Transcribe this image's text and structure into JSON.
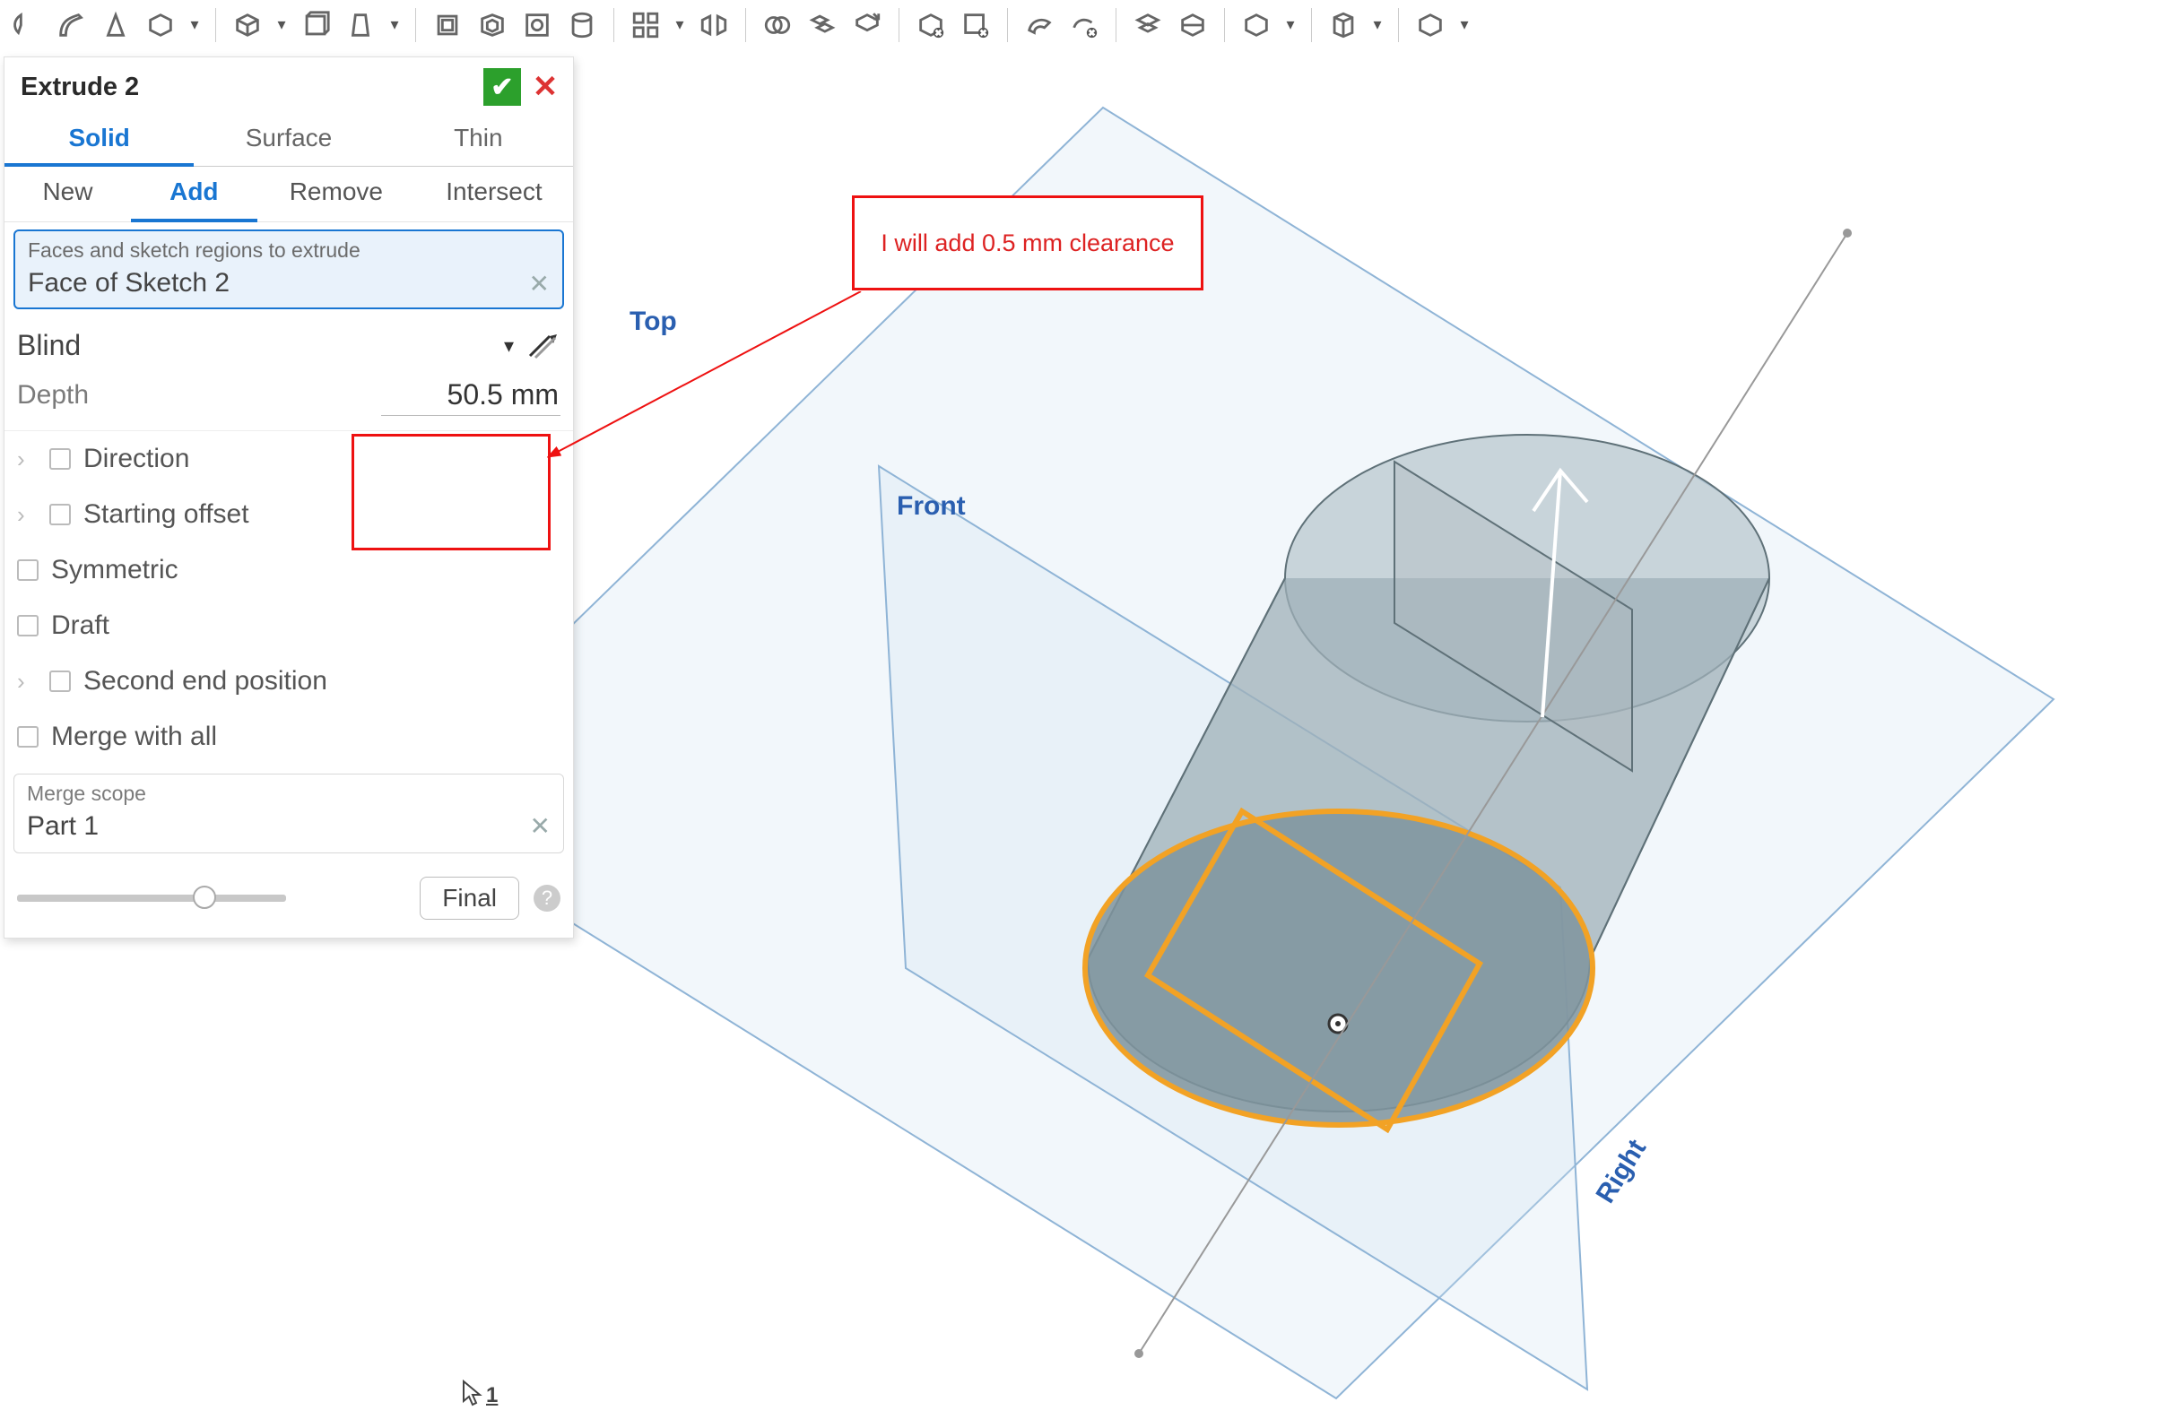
{
  "toolbar": {
    "icons": [
      "sketch-icon",
      "revolve-icon",
      "loft-icon",
      "thicken-icon",
      "sweep-icon",
      "extrude-icon",
      "surf1-icon",
      "surf2-icon",
      "surf3-icon",
      "fill-icon",
      "offset-icon",
      "plane-icon",
      "surf4-icon",
      "split-icon",
      "section-icon",
      "boolean-icon",
      "transform1-icon",
      "transform2-icon",
      "delete1-icon",
      "delete2-icon",
      "import1-icon",
      "import2-icon",
      "mirror-icon",
      "pattern-icon",
      "frame1-icon",
      "frame2-icon",
      "frame3-icon"
    ]
  },
  "panel": {
    "title": "Extrude 2",
    "tabs1": {
      "items": [
        "Solid",
        "Surface",
        "Thin"
      ],
      "active": 0
    },
    "tabs2": {
      "items": [
        "New",
        "Add",
        "Remove",
        "Intersect"
      ],
      "active": 1
    },
    "selection": {
      "label": "Faces and sketch regions to extrude",
      "value": "Face of Sketch 2"
    },
    "end_type": "Blind",
    "depth": {
      "label": "Depth",
      "value": "50.5 mm"
    },
    "options": {
      "direction": "Direction",
      "starting_offset": "Starting offset",
      "symmetric": "Symmetric",
      "draft": "Draft",
      "second_end": "Second end position",
      "merge_all": "Merge with all"
    },
    "merge_scope": {
      "label": "Merge scope",
      "value": "Part 1"
    },
    "final_label": "Final"
  },
  "annotation": {
    "text": "I will add 0.5 mm clearance"
  },
  "planes": {
    "top": "Top",
    "front": "Front",
    "right": "Right"
  },
  "cursor_badge": "1"
}
